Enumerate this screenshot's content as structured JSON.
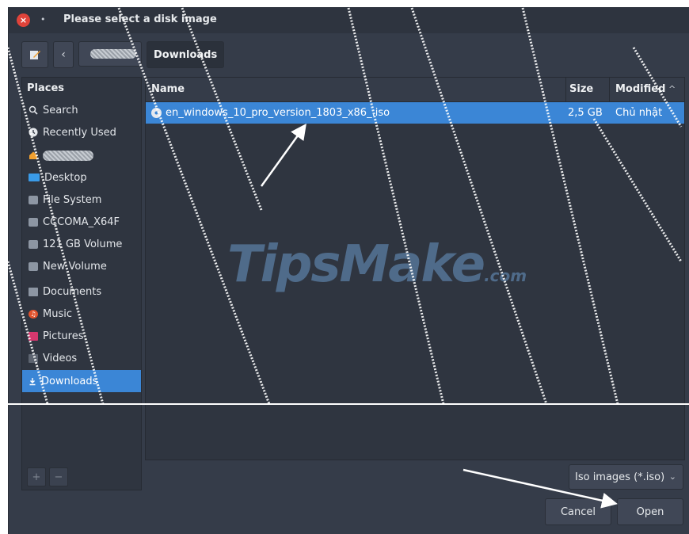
{
  "window": {
    "title": "Please select a disk image",
    "close_symbol": "×",
    "pin_symbol": "•"
  },
  "pathbar": {
    "back_symbol": "‹",
    "current": "Downloads"
  },
  "sidebar": {
    "header": "Places",
    "items": [
      {
        "label": "Search",
        "icon": "search-icon"
      },
      {
        "label": "Recently Used",
        "icon": "recent-icon"
      },
      {
        "label": "",
        "icon": "home-icon"
      },
      {
        "label": "Desktop",
        "icon": "desktop-folder-icon"
      },
      {
        "label": "File System",
        "icon": "drive-icon"
      },
      {
        "label": "CCCOMA_X64F",
        "icon": "drive-icon"
      },
      {
        "label": "121 GB Volume",
        "icon": "drive-icon"
      },
      {
        "label": "New Volume",
        "icon": "drive-icon"
      },
      {
        "label": "Documents",
        "icon": "documents-icon"
      },
      {
        "label": "Music",
        "icon": "music-icon"
      },
      {
        "label": "Pictures",
        "icon": "pictures-icon"
      },
      {
        "label": "Videos",
        "icon": "videos-icon"
      },
      {
        "label": "Downloads",
        "icon": "download-icon"
      }
    ],
    "selected": "Downloads",
    "add_symbol": "+",
    "remove_symbol": "−"
  },
  "filelist": {
    "columns": {
      "name": "Name",
      "size": "Size",
      "modified": "Modified"
    },
    "sort_symbol": "^",
    "rows": [
      {
        "name": "en_windows_10_pro_version_1803_x86_.iso",
        "size": "2,5 GB",
        "modified": "Chủ nhật",
        "selected": true
      }
    ]
  },
  "filter": {
    "value": "Iso images (*.iso)",
    "chevron": "⌄"
  },
  "buttons": {
    "cancel": "Cancel",
    "open": "Open"
  },
  "watermark": {
    "text": "TipsMake",
    "suffix": ".com"
  },
  "colors": {
    "accent": "#3b86d6",
    "background": "#353c49",
    "panel": "#2f3540",
    "close": "#e0433a"
  }
}
